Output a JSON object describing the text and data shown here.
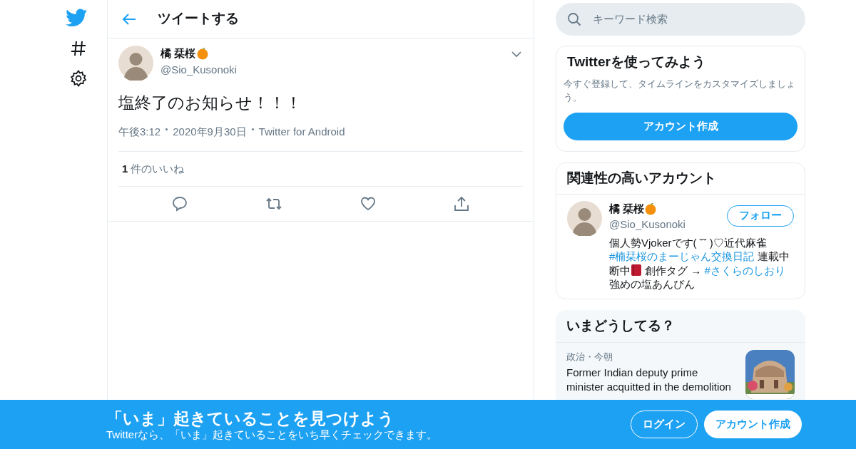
{
  "header": {
    "title": "ツイートする"
  },
  "tweet": {
    "name": "橘 栞桜",
    "handle": "@Sio_Kusonoki",
    "text": "塩終了のお知らせ！！！",
    "time": "午後3:12",
    "date": "2020年9月30日",
    "source": "Twitter for Android",
    "like_count": "1",
    "like_label": "件のいいね"
  },
  "search": {
    "placeholder": "キーワード検索"
  },
  "signup": {
    "title": "Twitterを使ってみよう",
    "text": "今すぐ登録して、タイムラインをカスタマイズしましょう。",
    "button": "アカウント作成"
  },
  "related": {
    "title": "関連性の高いアカウント",
    "name": "橘 栞桜",
    "handle": "@Sio_Kusonoki",
    "follow": "フォロー",
    "bio": [
      {
        "kind": "text",
        "text": "個人勢Vjokerです( ˘˘ )♡近代麻雀 "
      },
      {
        "kind": "link",
        "text": "#楠栞桜のまーじゃん交換日記"
      },
      {
        "kind": "text",
        "text": " 連載中断中"
      },
      {
        "kind": "book"
      },
      {
        "kind": "text",
        "text": " 創作タグ → "
      },
      {
        "kind": "link",
        "text": "#さくらのしおり"
      },
      {
        "kind": "text",
        "text": " 強めの塩あんぴん"
      }
    ]
  },
  "trends": {
    "title": "いまどうしてる？",
    "items": [
      {
        "meta": "政治・今朝",
        "text": "Former Indian deputy prime minister acquitted in the demolition",
        "kind": "picture"
      }
    ]
  },
  "banner": {
    "title": "「いま」起きていることを見つけよう",
    "subtitle": "Twitterなら、「いま」起きていることをいち早くチェックできます。",
    "login": "ログイン",
    "signup": "アカウント作成"
  }
}
